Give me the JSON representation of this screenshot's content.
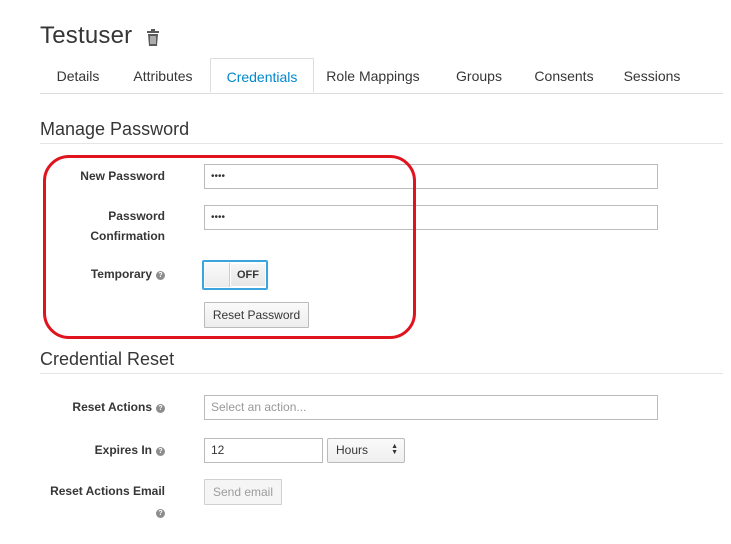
{
  "header": {
    "title": "Testuser",
    "delete_icon": "trash-icon"
  },
  "tabs": [
    {
      "label": "Details",
      "active": false
    },
    {
      "label": "Attributes",
      "active": false
    },
    {
      "label": "Credentials",
      "active": true
    },
    {
      "label": "Role Mappings",
      "active": false
    },
    {
      "label": "Groups",
      "active": false
    },
    {
      "label": "Consents",
      "active": false
    },
    {
      "label": "Sessions",
      "active": false
    }
  ],
  "manage_password": {
    "title": "Manage Password",
    "new_password_label": "New Password",
    "new_password_value": "••••",
    "confirm_label_line1": "Password",
    "confirm_label_line2": "Confirmation",
    "confirm_value": "••••",
    "temporary_label": "Temporary",
    "temporary_state": "OFF",
    "reset_button": "Reset Password"
  },
  "credential_reset": {
    "title": "Credential Reset",
    "reset_actions_label": "Reset Actions",
    "reset_actions_placeholder": "Select an action...",
    "expires_label": "Expires In",
    "expires_value": "12",
    "expires_unit": "Hours",
    "email_label": "Reset Actions Email",
    "send_email_button": "Send email"
  },
  "colors": {
    "accent": "#0088ce",
    "highlight": "#e0141e",
    "toggle_border": "#39a5dc"
  }
}
